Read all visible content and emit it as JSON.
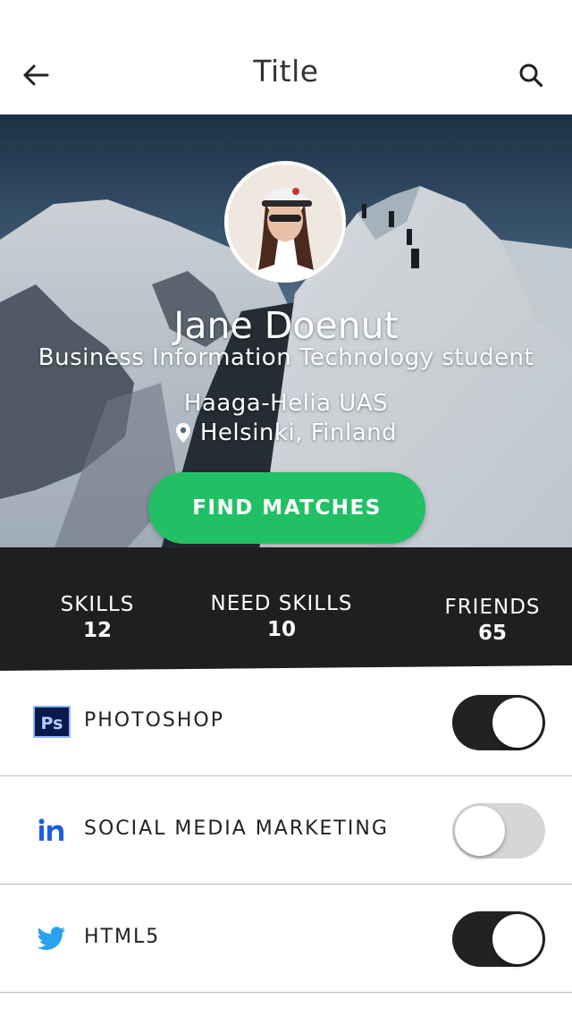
{
  "header": {
    "title": "Title",
    "back_icon": "arrow-left-icon",
    "search_icon": "search-icon"
  },
  "profile": {
    "name": "Jane Doenut",
    "role": "Business Information Technology student",
    "school": "Haaga-Helia UAS",
    "location": "Helsinki, Finland",
    "location_icon": "map-pin-icon",
    "cta_label": "FIND MATCHES"
  },
  "stats": [
    {
      "label": "SKILLS",
      "value": "12"
    },
    {
      "label": "NEED SKILLS",
      "value": "10"
    },
    {
      "label": "FRIENDS",
      "value": "65"
    }
  ],
  "skills": [
    {
      "label": "PHOTOSHOP",
      "icon": "photoshop-icon",
      "enabled": true
    },
    {
      "label": "SOCIAL MEDIA MARKETING",
      "icon": "linkedin-icon",
      "enabled": false
    },
    {
      "label": "HTML5",
      "icon": "twitter-icon",
      "enabled": true
    }
  ],
  "colors": {
    "accent_green": "#22c065",
    "stats_band": "#1f1f1f",
    "toggle_on": "#222222",
    "toggle_off": "#d6d6d6",
    "linkedin_blue": "#1d5fe0",
    "twitter_blue": "#2aa3ef"
  }
}
